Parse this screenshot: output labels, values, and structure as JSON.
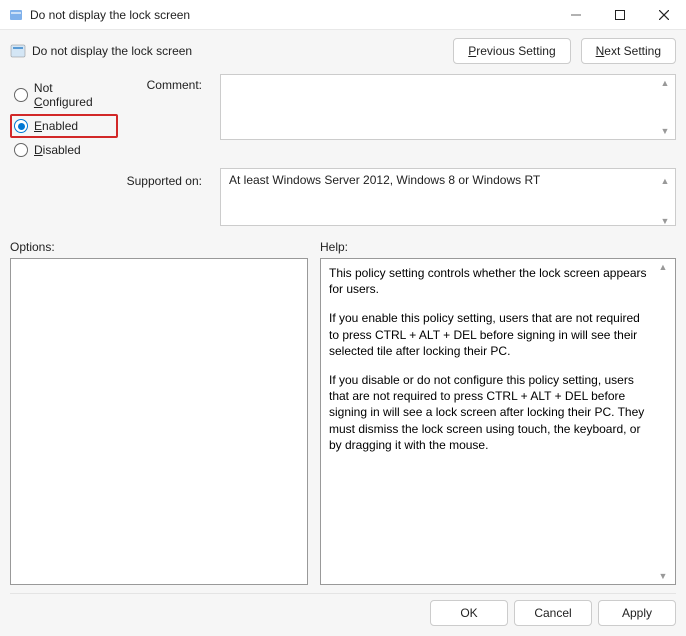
{
  "titlebar": {
    "title": "Do not display the lock screen"
  },
  "header": {
    "title": "Do not display the lock screen",
    "previous_setting": "Previous Setting",
    "next_setting": "Next Setting"
  },
  "radio": {
    "not_configured": "Not Configured",
    "enabled": "Enabled",
    "disabled": "Disabled",
    "selected": "enabled"
  },
  "labels": {
    "comment": "Comment:",
    "supported_on": "Supported on:",
    "options": "Options:",
    "help": "Help:"
  },
  "supported_on": "At least Windows Server 2012, Windows 8 or Windows RT",
  "help_text": {
    "p1": "This policy setting controls whether the lock screen appears for users.",
    "p2": "If you enable this policy setting, users that are not required to press CTRL + ALT + DEL before signing in will see their selected tile after locking their PC.",
    "p3": "If you disable or do not configure this policy setting, users that are not required to press CTRL + ALT + DEL before signing in will see a lock screen after locking their PC. They must dismiss the lock screen using touch, the keyboard, or by dragging it with the mouse."
  },
  "footer": {
    "ok": "OK",
    "cancel": "Cancel",
    "apply": "Apply"
  }
}
